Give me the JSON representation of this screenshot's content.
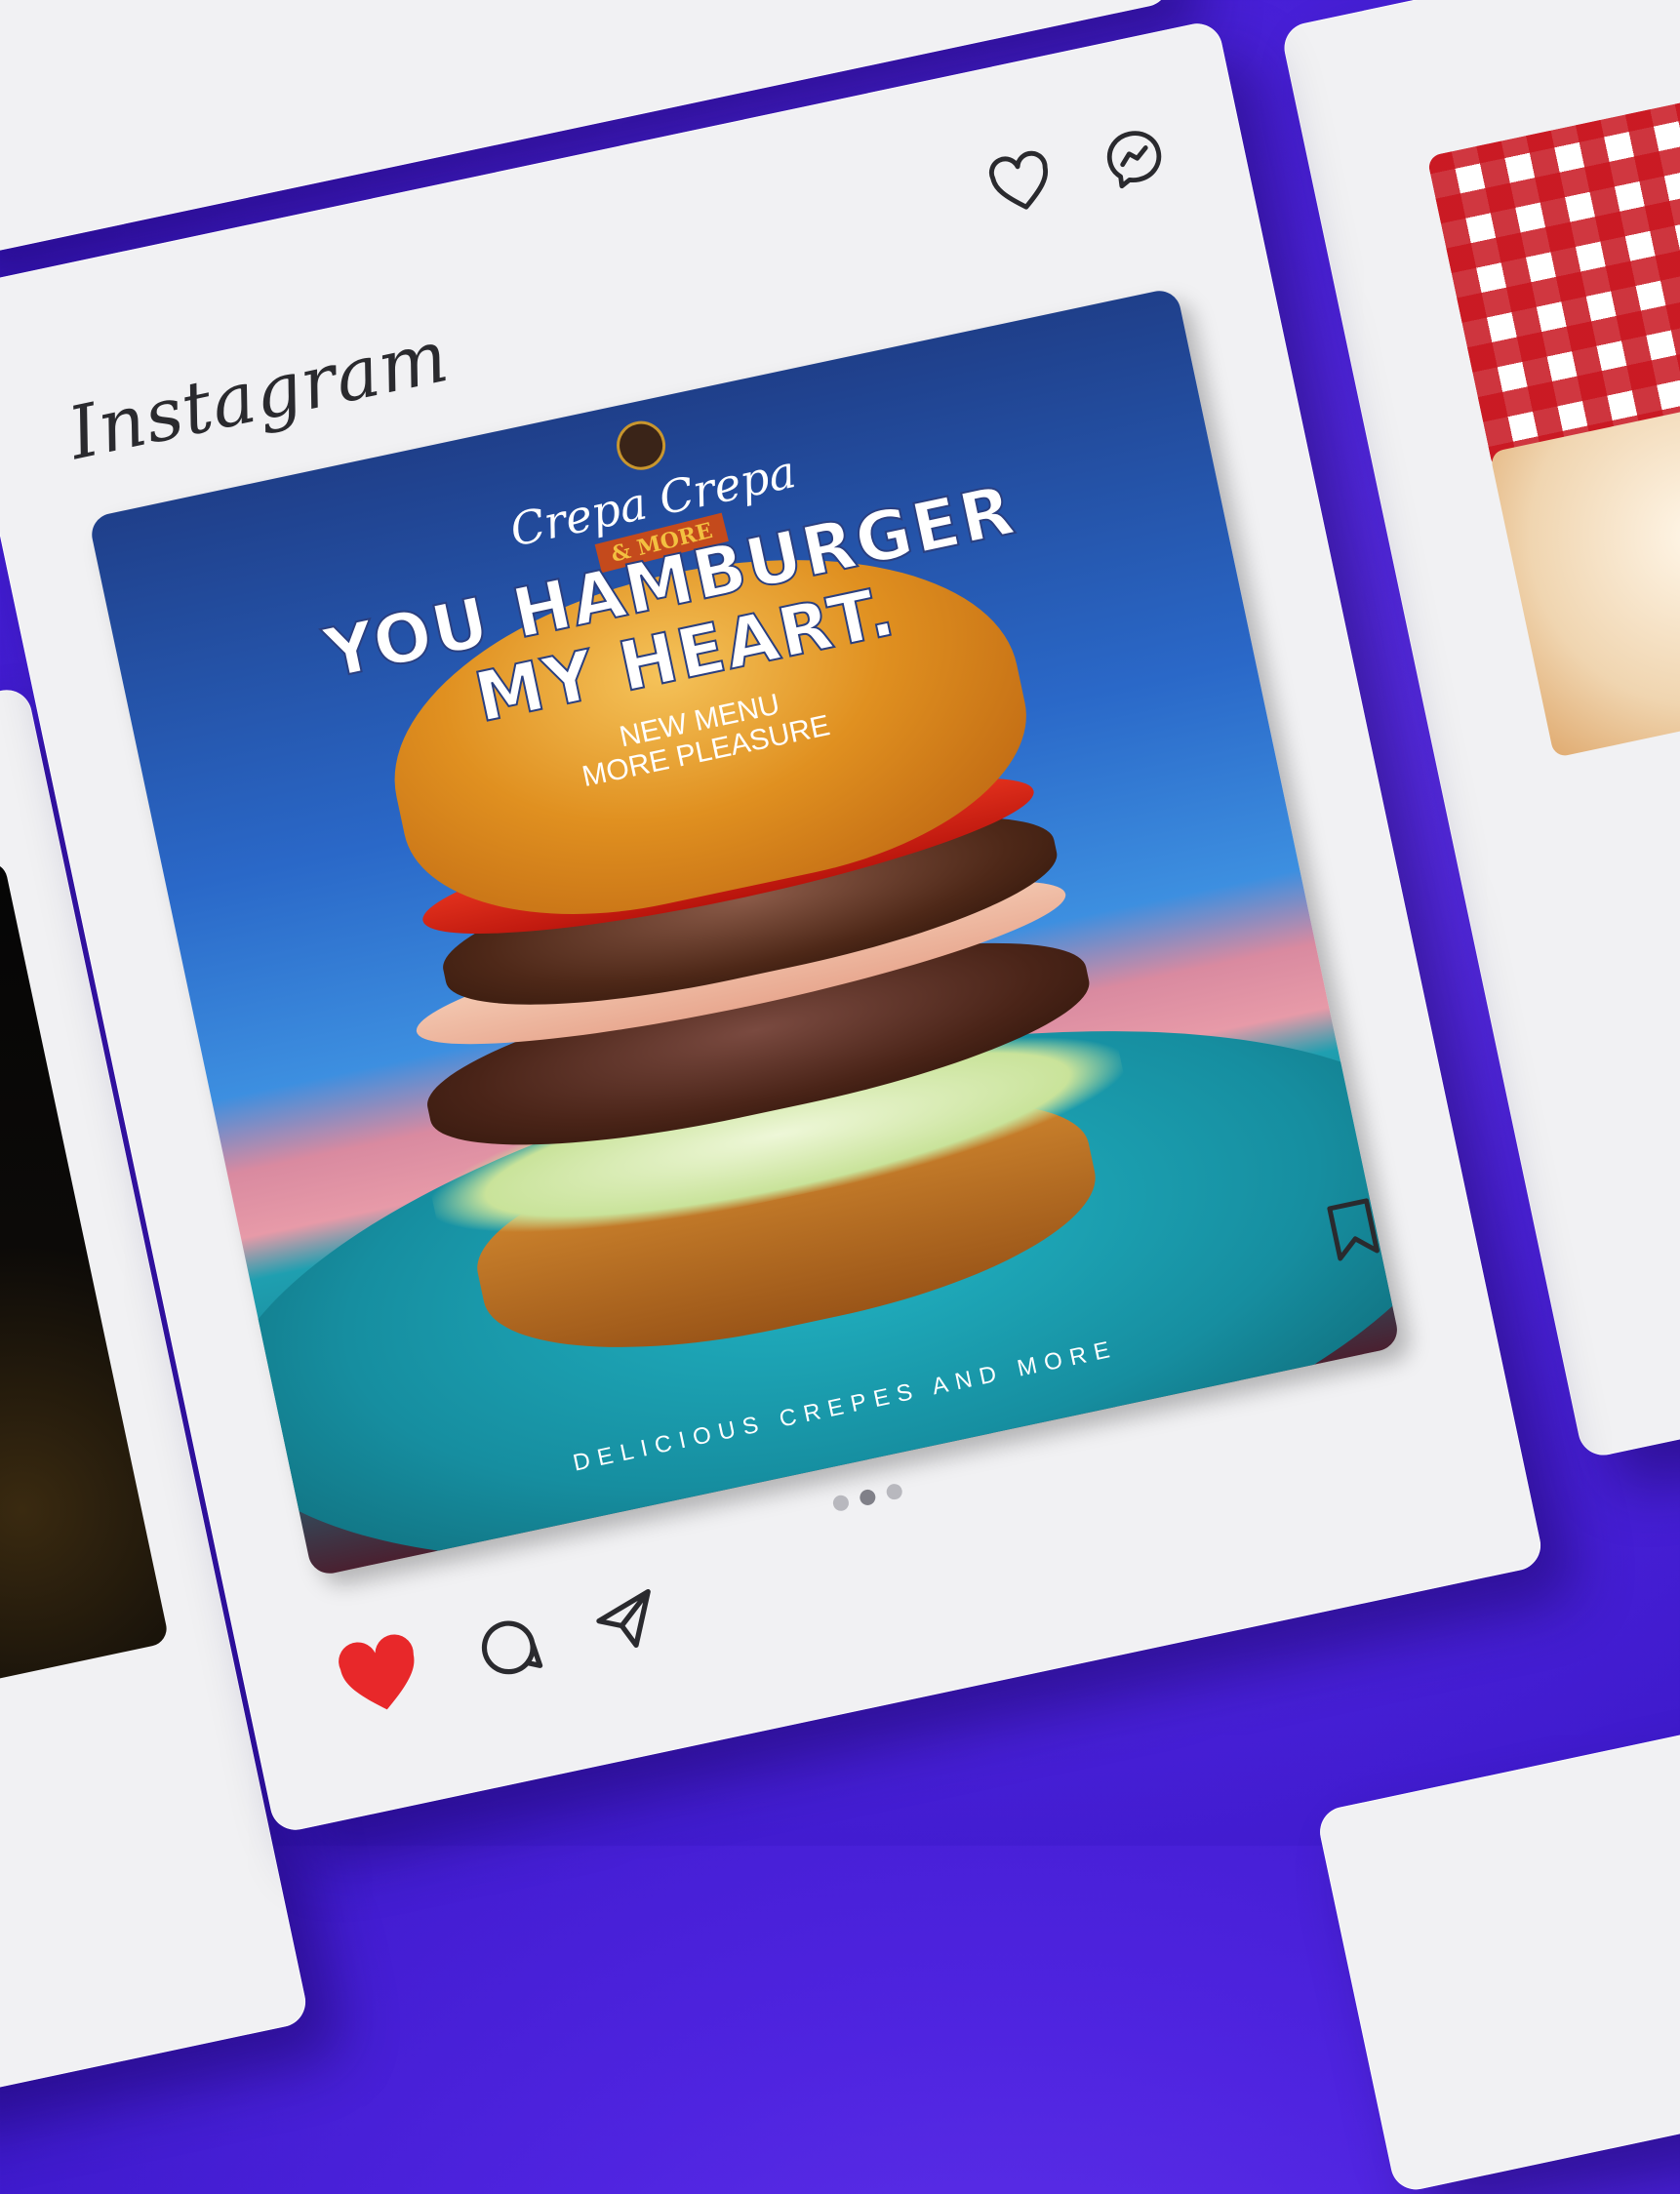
{
  "app": {
    "title": "Instagram"
  },
  "post": {
    "brand_name": "Crepa Crepa",
    "brand_sub": "& MORE",
    "headline_line1": "YOU HAMBURGER",
    "headline_line2": "MY HEART.",
    "subline1": "NEW MENU",
    "subline2": "MORE PLEASURE",
    "tagline": "DELICIOUS CREPES AND MORE"
  },
  "pagination": {
    "total": 3,
    "active": 2
  },
  "icons": {
    "like": "heart-outline-icon",
    "messenger": "messenger-icon",
    "liked": "heart-filled-icon",
    "comment": "comment-icon",
    "share": "send-icon",
    "save": "bookmark-icon"
  },
  "colors": {
    "background": "#5a2ee8",
    "card": "#f1f1f3",
    "liked_heart": "#e8282a",
    "icon_stroke": "#2a2a2e"
  }
}
